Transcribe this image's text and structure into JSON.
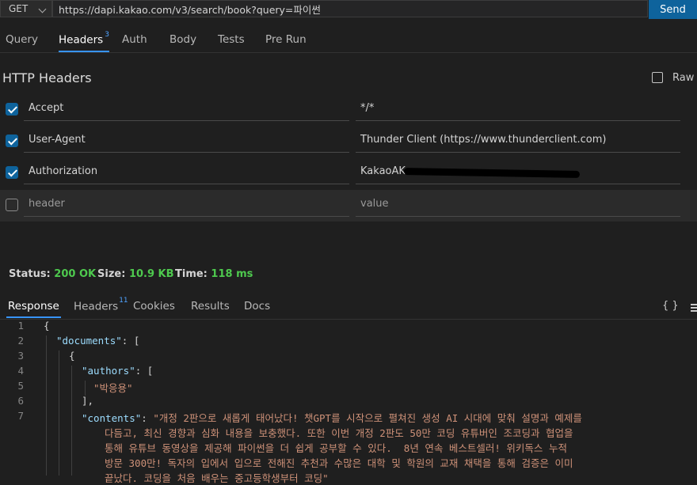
{
  "request": {
    "method": "GET",
    "url": "https://dapi.kakao.com/v3/search/book?query=파이썬",
    "send_label": "Send"
  },
  "request_tabs": [
    {
      "label": "Query"
    },
    {
      "label": "Headers",
      "badge": "3"
    },
    {
      "label": "Auth"
    },
    {
      "label": "Body"
    },
    {
      "label": "Tests"
    },
    {
      "label": "Pre Run"
    }
  ],
  "headers_section": {
    "title": "HTTP Headers",
    "raw_label": "Raw",
    "rows": [
      {
        "key": "Accept",
        "value": "*/*",
        "checked": true
      },
      {
        "key": "User-Agent",
        "value": "Thunder Client (https://www.thunderclient.com)",
        "checked": true
      },
      {
        "key": "Authorization",
        "value": "KakaoAK",
        "checked": true
      },
      {
        "key": "header",
        "value": "value",
        "checked": false
      }
    ]
  },
  "status": {
    "status_label": "Status:",
    "status_value": "200 OK",
    "size_label": "Size:",
    "size_value": "10.9 KB",
    "time_label": "Time:",
    "time_value": "118 ms"
  },
  "response_tabs": [
    {
      "label": "Response"
    },
    {
      "label": "Headers",
      "badge": "11"
    },
    {
      "label": "Cookies"
    },
    {
      "label": "Results"
    },
    {
      "label": "Docs"
    }
  ],
  "response_toolbar": {
    "braces": "{ }"
  },
  "code": {
    "line_numbers": [
      "1",
      "2",
      "3",
      "4",
      "5",
      "6",
      "7"
    ],
    "l1": "{",
    "l2_key": "\"documents\"",
    "l2_rest": ": [",
    "l3": "{",
    "l4_key": "\"authors\"",
    "l4_rest": ": [",
    "l5": "\"박응용\"",
    "l6": "],",
    "l7_key": "\"contents\"",
    "l7_sep": ": ",
    "l7_v1": "\"개정 2판으로 새롭게 태어났다! 챗GPT를 시작으로 펼쳐진 생성 AI 시대에 맞춰 설명과 예제를",
    "l7_v2": "다듬고, 최신 경향과 심화 내용을 보충했다. 또한 이번 개정 2판도 50만 코딩 유튜버인 조코딩과 협업을",
    "l7_v3": "통해 유튜브 동영상을 제공해 파이썬을 더 쉽게 공부할 수 있다.  8년 연속 베스트셀러! 위키독스 누적",
    "l7_v4": "방문 300만! 독자의 입에서 입으로 전해진 추천과 수많은 대학 및 학원의 교재 채택을 통해 검증은 이미",
    "l7_v5": "끝났다. 코딩을 처음 배우는 중고등학생부터 코딩\""
  }
}
